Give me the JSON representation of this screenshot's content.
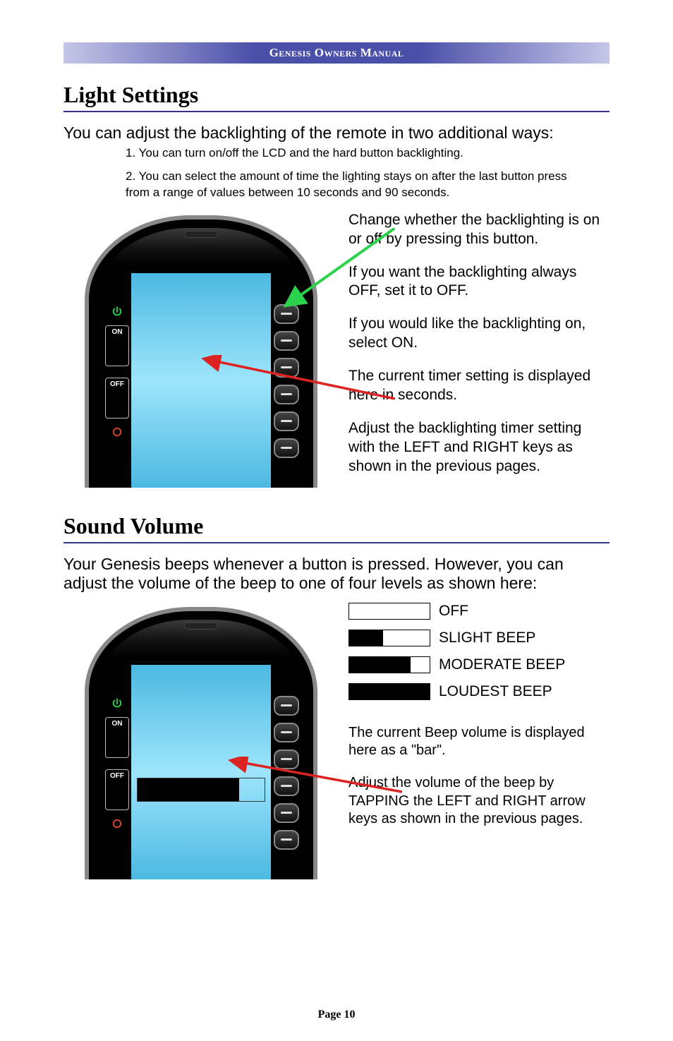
{
  "banner": "Genesis Owners Manual",
  "section1": {
    "heading": "Light Settings",
    "intro": "You can adjust the backlighting of the remote in two additional ways:",
    "items": [
      "1. You can turn on/off the LCD and the hard button backlighting.",
      "2. You can select the amount of time the lighting stays on after the last button press from a range of values between 10 seconds and 90 seconds."
    ],
    "callouts": [
      "Change whether the backlighting is on or off by pressing this button.",
      "If you want the backlighting always OFF, set it to OFF.",
      "If you would like the backlighting on, select ON.",
      "The current timer setting is displayed here in seconds.",
      "Adjust the backlighting timer setting with the LEFT and RIGHT keys as shown in the previous pages."
    ],
    "device_labels": {
      "on": "ON",
      "off": "OFF"
    }
  },
  "section2": {
    "heading": "Sound Volume",
    "intro": "Your Genesis beeps whenever a button is pressed. However, you can adjust the volume of the beep to one of four levels as shown here:",
    "legend": [
      {
        "label": "OFF",
        "fill_pct": 0
      },
      {
        "label": "SLIGHT BEEP",
        "fill_pct": 42
      },
      {
        "label": "MODERATE BEEP",
        "fill_pct": 76
      },
      {
        "label": "LOUDEST BEEP",
        "fill_pct": 100
      }
    ],
    "callouts": [
      "The current Beep volume is displayed here as a \"bar\".",
      "Adjust the volume of the beep by TAPPING the LEFT and RIGHT arrow keys as shown in the previous pages."
    ],
    "device_labels": {
      "on": "ON",
      "off": "OFF"
    },
    "bar_fill_pct": 80
  },
  "footer": "Page 10"
}
